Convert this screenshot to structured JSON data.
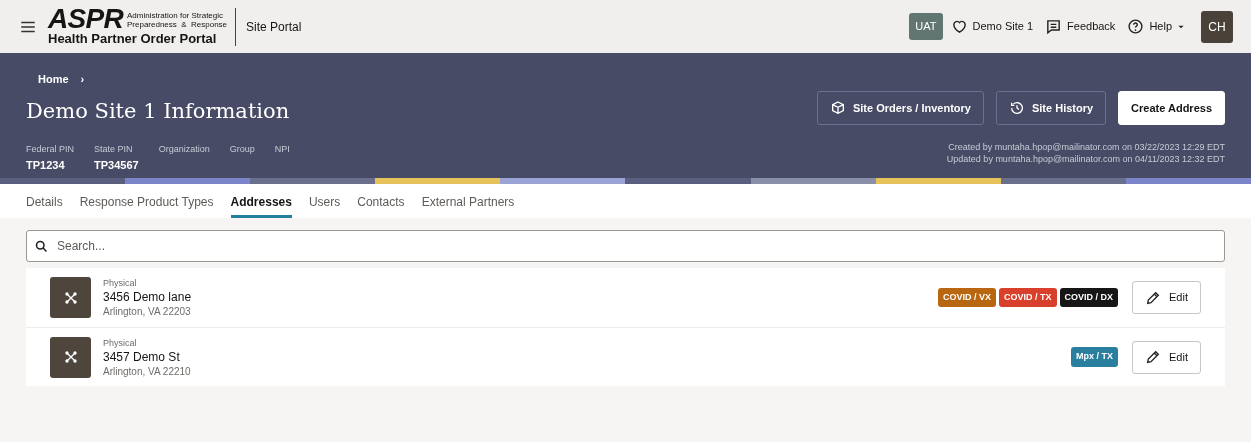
{
  "header": {
    "logo": {
      "mark": "ASPR",
      "subtitle_line_1": "Administration for Strategic",
      "subtitle_line_2": "Preparedness  &  Response",
      "tagline": "Health Partner Order Portal"
    },
    "portal_name": "Site Portal",
    "environment_badge": "UAT",
    "site": "Demo Site 1",
    "feedback": "Feedback",
    "help": "Help",
    "avatar_initials": "CH"
  },
  "banner": {
    "breadcrumb": "Home",
    "breadcrumb_separator": "›",
    "title": "Demo Site 1 Information",
    "fields": [
      {
        "label": "Federal PIN",
        "value": "TP1234"
      },
      {
        "label": "State PIN",
        "value": "TP34567"
      },
      {
        "label": "Organization"
      },
      {
        "label": "Group"
      },
      {
        "label": "NPI"
      }
    ],
    "buttons": [
      {
        "kind": "orders",
        "label": "Site Orders / Inventory"
      },
      {
        "kind": "history",
        "label": "Site History"
      },
      {
        "kind": "primary",
        "label": "Create Address"
      }
    ],
    "audit": [
      "Created by muntaha.hpop@mailinator.com on 03/22/2023 12:29 EDT",
      "Updated by muntaha.hpop@mailinator.com on 04/11/2023 12:32 EDT"
    ]
  },
  "tabs": [
    {
      "label": "Details",
      "selected": false
    },
    {
      "label": "Response Product Types",
      "selected": false
    },
    {
      "label": "Addresses",
      "selected": true
    },
    {
      "label": "Users",
      "selected": false
    },
    {
      "label": "Contacts",
      "selected": false
    },
    {
      "label": "External Partners",
      "selected": false
    }
  ],
  "search": {
    "placeholder": "Search..."
  },
  "addresses": [
    {
      "type": "Physical",
      "street": "3456 Demo lane",
      "city": "Arlington, VA 22203",
      "tags": [
        {
          "label": "COVID / VX",
          "color": "#b8660f"
        },
        {
          "label": "COVID / TX",
          "color": "#d9402b"
        },
        {
          "label": "COVID / DX",
          "color": "#161616"
        }
      ],
      "action": "Edit"
    },
    {
      "type": "Physical",
      "street": "3457 Demo St",
      "city": "Arlington, VA 22210",
      "tags": [
        {
          "label": "Mpx / TX",
          "color": "#2a7f9e"
        }
      ],
      "action": "Edit"
    }
  ]
}
